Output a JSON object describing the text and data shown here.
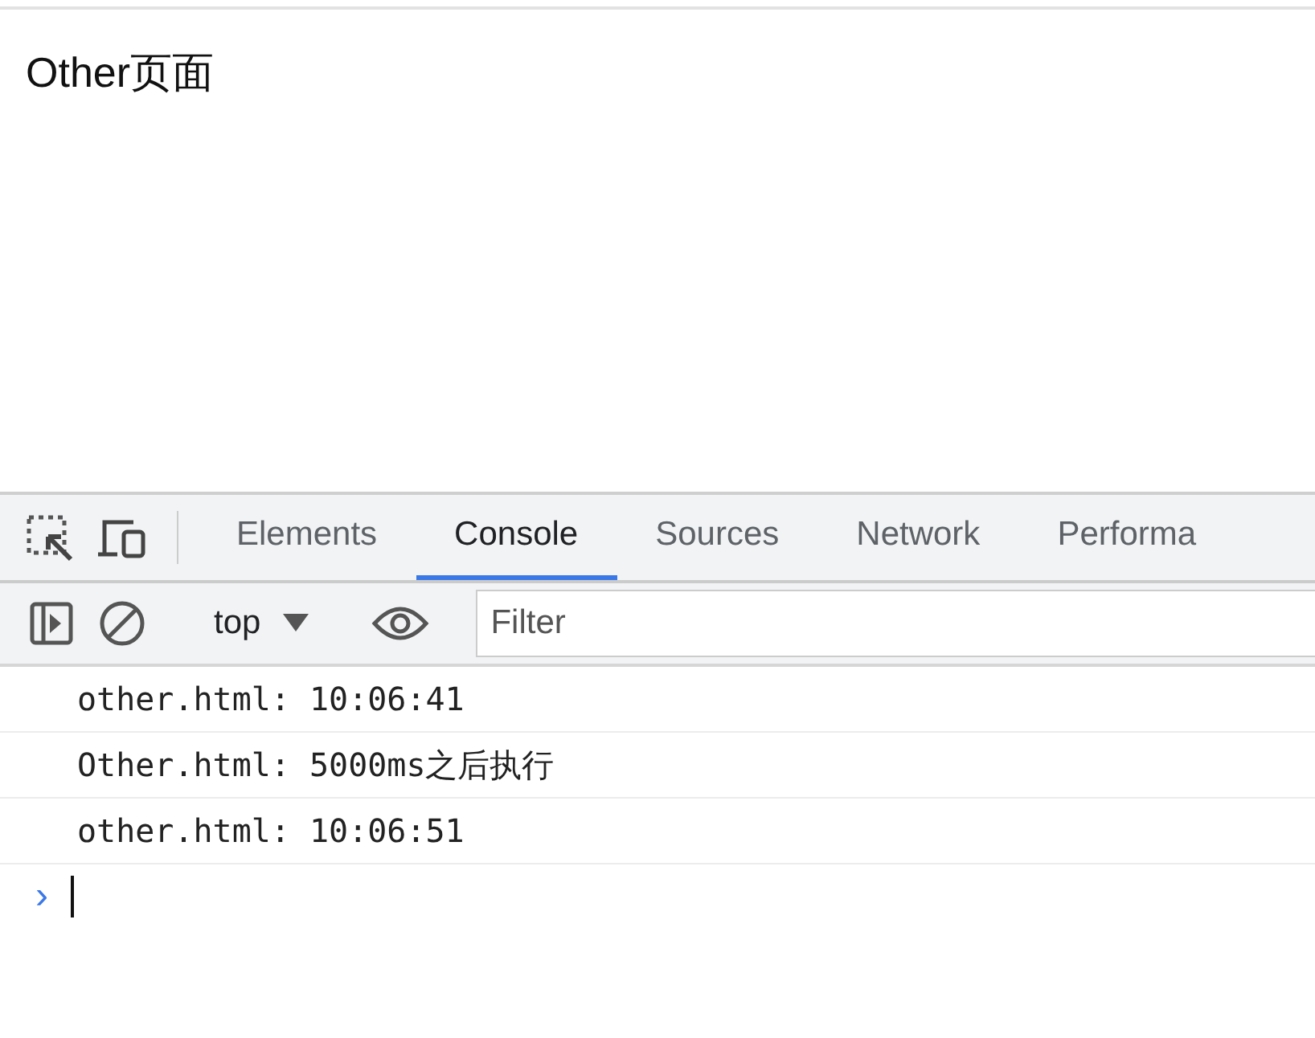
{
  "page": {
    "heading": "Other页面"
  },
  "devtools": {
    "tabs": [
      {
        "label": "Elements",
        "selected": false
      },
      {
        "label": "Console",
        "selected": true
      },
      {
        "label": "Sources",
        "selected": false
      },
      {
        "label": "Network",
        "selected": false
      },
      {
        "label": "Performa",
        "selected": false
      }
    ],
    "context": "top",
    "filter": {
      "placeholder": "Filter"
    },
    "messages": [
      "other.html: 10:06:41",
      "Other.html: 5000ms之后执行",
      "other.html: 10:06:51"
    ],
    "prompt": "›"
  }
}
